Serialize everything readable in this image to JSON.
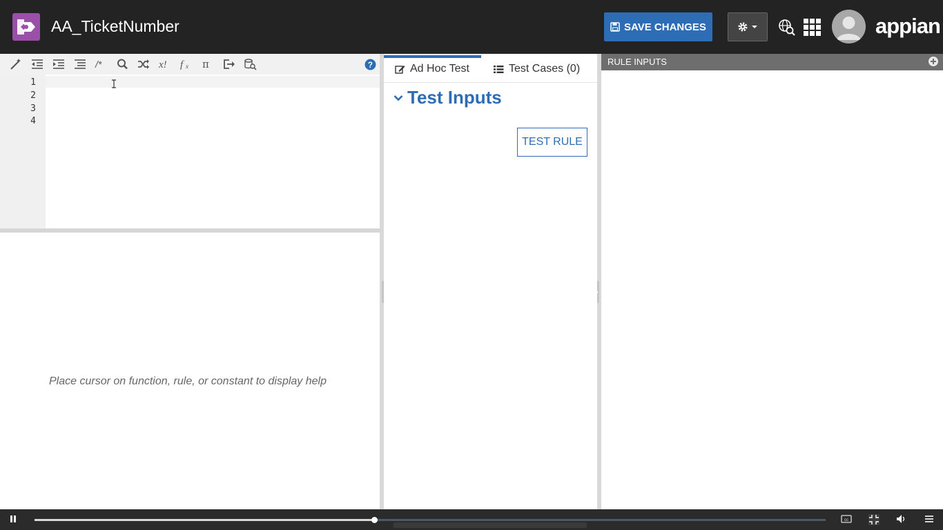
{
  "header": {
    "title": "AA_TicketNumber",
    "save_label": "SAVE CHANGES",
    "brand": "appian"
  },
  "editor": {
    "line_numbers": [
      "1",
      "2",
      "3",
      "4"
    ],
    "help_text": "Place cursor on function, rule, or constant to display help"
  },
  "test_panel": {
    "tabs": [
      {
        "label": "Ad Hoc Test",
        "icon": "edit-icon"
      },
      {
        "label": "Test Cases (0)",
        "icon": "list-icon"
      }
    ],
    "section_title": "Test Inputs",
    "test_button": "TEST RULE"
  },
  "rule_inputs": {
    "title": "RULE INPUTS"
  },
  "player": {
    "progress": 0.43
  },
  "colors": {
    "topbar": "#232323",
    "accent": "#2d6db5",
    "logo": "#9a4fa8",
    "rule_header": "#6e6e6e"
  }
}
